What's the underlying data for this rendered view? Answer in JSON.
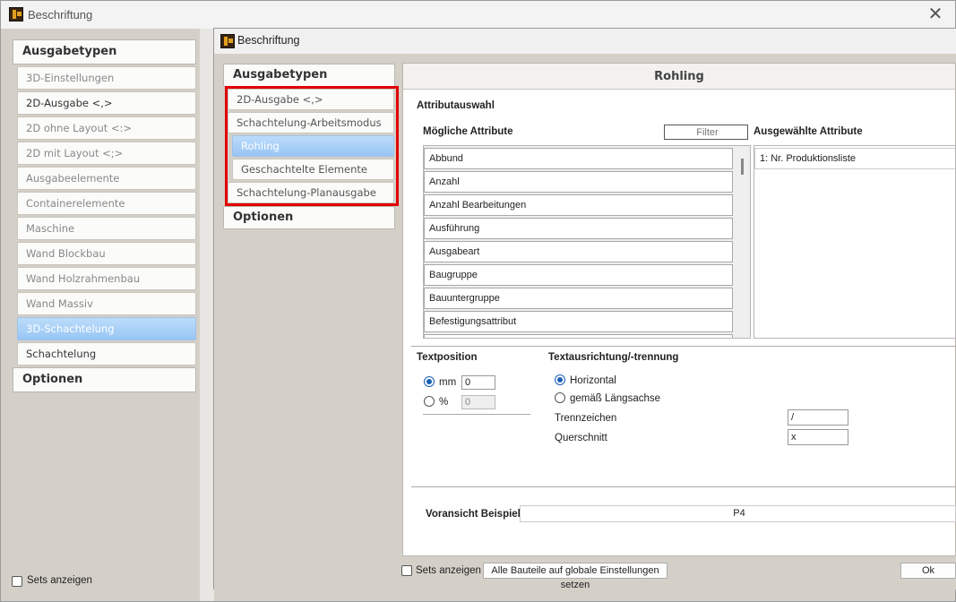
{
  "outer_window": {
    "title": "Beschriftung",
    "category_header": "Ausgabetypen",
    "items": [
      {
        "label": "3D-Einstellungen",
        "style": "muted"
      },
      {
        "label": "2D-Ausgabe <,>",
        "style": "dark"
      },
      {
        "label": "2D ohne Layout <:>",
        "style": "muted"
      },
      {
        "label": "2D mit Layout <;>",
        "style": "muted"
      },
      {
        "label": "Ausgabeelemente",
        "style": "muted"
      },
      {
        "label": "Containerelemente",
        "style": "muted"
      },
      {
        "label": "Maschine",
        "style": "muted"
      },
      {
        "label": "Wand Blockbau",
        "style": "muted"
      },
      {
        "label": "Wand Holzrahmenbau",
        "style": "muted"
      },
      {
        "label": "Wand Massiv",
        "style": "muted"
      },
      {
        "label": "3D-Schachtelung",
        "style": "selected"
      },
      {
        "label": "Schachtelung",
        "style": "dark"
      }
    ],
    "options_header": "Optionen",
    "show_sets_label": "Sets anzeigen"
  },
  "inner_window": {
    "title": "Beschriftung",
    "category_header": "Ausgabetypen",
    "items": [
      {
        "label": "2D-Ausgabe <,>",
        "style": "normal"
      },
      {
        "label": "Schachtelung-Arbeitsmodus",
        "style": "normal"
      },
      {
        "label": "Rohling",
        "style": "selected"
      },
      {
        "label": "Geschachtelte Elemente",
        "style": "normal"
      },
      {
        "label": "Schachtelung-Planausgabe",
        "style": "normal"
      }
    ],
    "options_header": "Optionen",
    "panel_title": "Rohling",
    "attr_section": "Attributauswahl",
    "possible_attrs_label": "Mögliche Attribute",
    "filter_placeholder": "Filter",
    "selected_attrs_label": "Ausgewählte Attribute",
    "possible_attrs": [
      "Abbund",
      "Anzahl",
      "Anzahl Bearbeitungen",
      "Ausführung",
      "Ausgabeart",
      "Baugruppe",
      "Bauuntergruppe",
      "Befestigungsattribut"
    ],
    "selected_attrs": [
      "1: Nr. Produktionsliste"
    ],
    "textpos_label": "Textposition",
    "mm_label": "mm",
    "mm_value": "0",
    "percent_label": "%",
    "percent_value": "0",
    "textdir_label": "Textausrichtung/-trennung",
    "horizontal_label": "Horizontal",
    "laengsachse_label": "gemäß Längsachse",
    "trennzeichen_label": "Trennzeichen",
    "trennzeichen_value": "/",
    "querschnitt_label": "Querschnitt",
    "querschnitt_value": "x",
    "preview_label": "Voransicht Beispiel",
    "preview_value": "P4",
    "show_sets_label": "Sets anzeigen",
    "global_button": "Alle Bauteile auf globale Einstellungen setzen",
    "ok_button": "Ok"
  },
  "colors": {
    "selection": "#98c6f4",
    "highlight_box": "#e00000",
    "radio_accent": "#1a5fb4"
  }
}
